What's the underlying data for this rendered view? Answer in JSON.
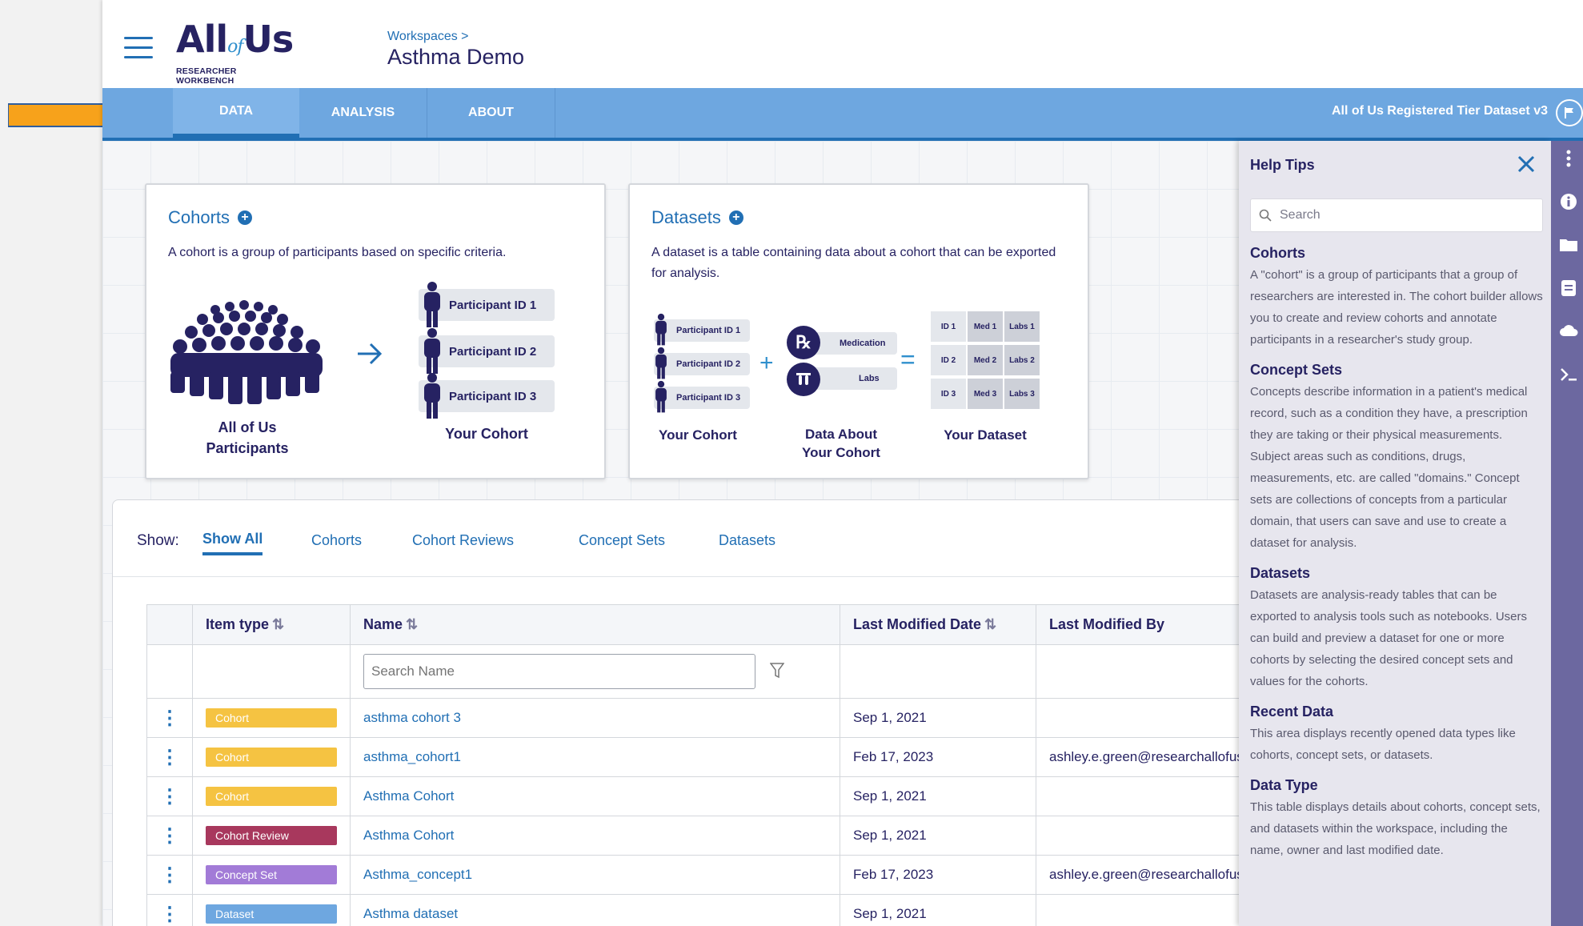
{
  "header": {
    "logo_main_a": "All",
    "logo_main_of": "of",
    "logo_main_b": "Us",
    "logo_sub": "RESEARCHER WORKBENCH",
    "breadcrumb": "Workspaces >",
    "workspace_title": "Asthma Demo"
  },
  "nav": {
    "tabs": [
      {
        "label": "DATA"
      },
      {
        "label": "ANALYSIS"
      },
      {
        "label": "ABOUT"
      }
    ],
    "tier_label": "All of Us Registered Tier Dataset v3"
  },
  "cohorts_card": {
    "title": "Cohorts",
    "description": "A cohort is a group of participants based on specific criteria.",
    "participants_caption_1": "All of Us",
    "participants_caption_2": "Participants",
    "ids": [
      "Participant ID 1",
      "Participant ID 2",
      "Participant ID 3"
    ],
    "your_cohort": "Your Cohort"
  },
  "datasets_card": {
    "title": "Datasets",
    "description": "A dataset is a table containing data about a cohort that can be exported for analysis.",
    "ids": [
      "Participant ID 1",
      "Participant ID 2",
      "Participant ID 3"
    ],
    "medication": "Medication",
    "labs": "Labs",
    "grid": [
      [
        "ID 1",
        "Med 1",
        "Labs 1"
      ],
      [
        "ID 2",
        "Med 2",
        "Labs 2"
      ],
      [
        "ID 3",
        "Med 3",
        "Labs 3"
      ]
    ],
    "your_cohort": "Your Cohort",
    "data_about_1": "Data About",
    "data_about_2": "Your Cohort",
    "your_dataset": "Your Dataset"
  },
  "resources": {
    "show_label": "Show:",
    "filter_tabs": [
      "Show All",
      "Cohorts",
      "Cohort Reviews",
      "Concept Sets",
      "Datasets"
    ],
    "columns": [
      "Item type",
      "Name",
      "Last Modified Date",
      "Last Modified By"
    ],
    "search_placeholder": "Search Name",
    "rows": [
      {
        "type": "Cohort",
        "color": "#f5c342",
        "name": "asthma cohort 3",
        "date": "Sep 1, 2021",
        "by": ""
      },
      {
        "type": "Cohort",
        "color": "#f5c342",
        "name": "asthma_cohort1",
        "date": "Feb 17, 2023",
        "by": "ashley.e.green@researchallofus.org"
      },
      {
        "type": "Cohort",
        "color": "#f5c342",
        "name": "Asthma Cohort",
        "date": "Sep 1, 2021",
        "by": ""
      },
      {
        "type": "Cohort Review",
        "color": "#a8385d",
        "name": "Asthma Cohort",
        "date": "Sep 1, 2021",
        "by": ""
      },
      {
        "type": "Concept Set",
        "color": "#a27bd7",
        "name": "Asthma_concept1",
        "date": "Feb 17, 2023",
        "by": "ashley.e.green@researchallofus.org"
      },
      {
        "type": "Dataset",
        "color": "#6ea7e0",
        "name": "Asthma dataset",
        "date": "Sep 1, 2021",
        "by": ""
      }
    ]
  },
  "help": {
    "title": "Help Tips",
    "search_placeholder": "Search",
    "sections": [
      {
        "heading": "Cohorts",
        "body": "A \"cohort\" is a group of participants that a group of researchers are interested in. The cohort builder allows you to create and review cohorts and annotate participants in a researcher's study group."
      },
      {
        "heading": "Concept Sets",
        "body": "Concepts describe information in a patient's medical record, such as a condition they have, a prescription they are taking or their physical measurements. Subject areas such as conditions, drugs, measurements, etc. are called \"domains.\" Concept sets are collections of concepts from a particular domain, that users can save and use to create a dataset for analysis."
      },
      {
        "heading": "Datasets",
        "body": "Datasets are analysis-ready tables that can be exported to analysis tools such as notebooks. Users can build and preview a dataset for one or more cohorts by selecting the desired concept sets and values for the cohorts."
      },
      {
        "heading": "Recent Data",
        "body": "This area displays recently opened data types like cohorts, concept sets, or datasets."
      },
      {
        "heading": "Data Type",
        "body": "This table displays details about cohorts, concept sets, and datasets within the workspace, including the name, owner and last modified date."
      }
    ]
  },
  "colors": {
    "brand_navy": "#262262",
    "brand_blue": "#216fb4",
    "nav_blue": "#6ea7e0",
    "annotation_arrow": "#f7a21b"
  }
}
